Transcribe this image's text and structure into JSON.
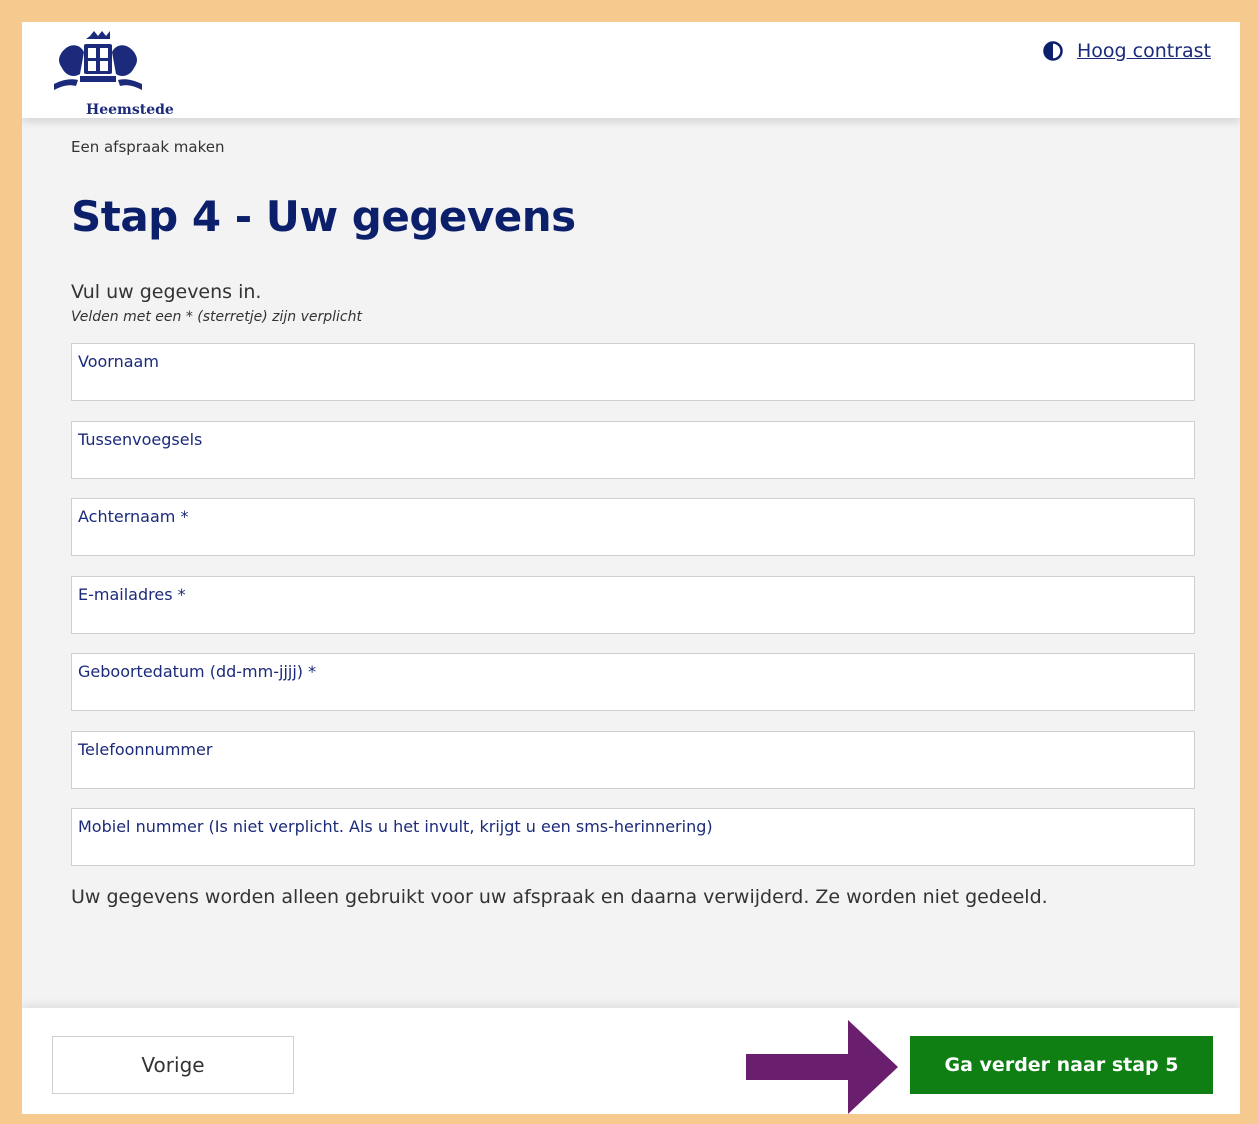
{
  "header": {
    "logo_text": "Heemstede",
    "contrast_link": "Hoog contrast"
  },
  "breadcrumb": "Een afspraak maken",
  "title": "Stap 4 - Uw gegevens",
  "intro": "Vul uw gegevens in.",
  "required_note": "Velden met een * (sterretje) zijn verplicht",
  "fields": [
    {
      "label": "Voornaam",
      "value": ""
    },
    {
      "label": "Tussenvoegsels",
      "value": ""
    },
    {
      "label": "Achternaam *",
      "value": ""
    },
    {
      "label": "E-mailadres *",
      "value": ""
    },
    {
      "label": "Geboortedatum (dd-mm-jjjj) *",
      "value": ""
    },
    {
      "label": "Telefoonnummer",
      "value": ""
    },
    {
      "label": "Mobiel nummer (Is niet verplicht. Als u het invult, krijgt u een sms-herinnering)",
      "value": ""
    }
  ],
  "privacy_text": "Uw gegevens worden alleen gebruikt voor uw afspraak en daarna verwijderd. Ze worden niet gedeeld.",
  "footer": {
    "prev_label": "Vorige",
    "next_label": "Ga verder naar stap 5"
  },
  "colors": {
    "frame_border": "#f6c98f",
    "heading": "#0c1f6b",
    "label": "#1b2a7a",
    "next_button": "#0f7f14",
    "arrow": "#6a1f6e"
  },
  "icons": {
    "contrast": "contrast-icon",
    "annotation_arrow": "arrow-right-icon"
  }
}
